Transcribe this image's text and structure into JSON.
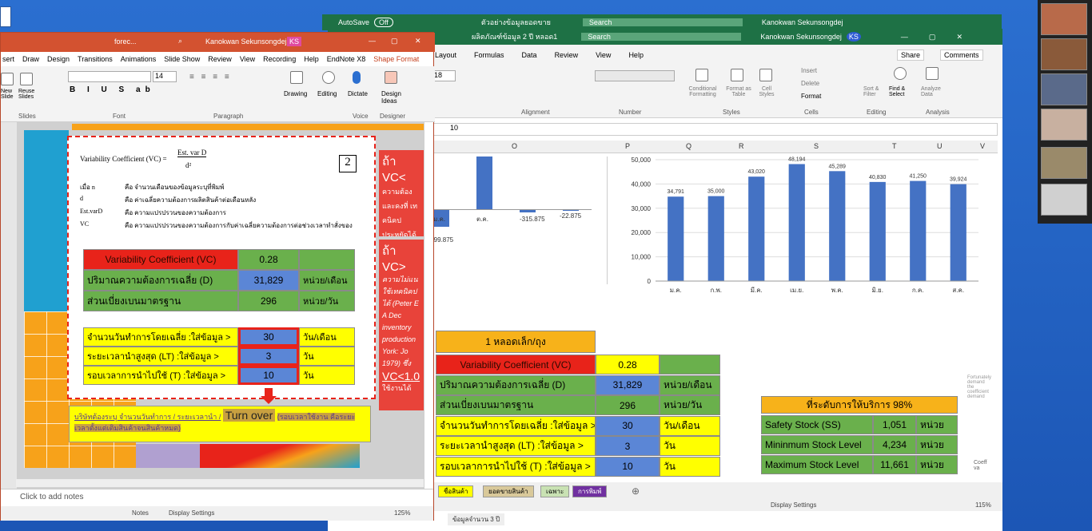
{
  "excel_back": {
    "autosave": "AutoSave",
    "autosave_state": "Off",
    "title": "ตัวอย่างข้อมูลยอดขาย",
    "search": "Search",
    "user": "Kanokwan Sekunsongdej",
    "initials": "KS"
  },
  "excel": {
    "title": "ผลิตภัณฑ์ข้อมูล 2 ปี หลอด1",
    "search": "Search",
    "user": "Kanokwan Sekunsongdej",
    "initials": "KS",
    "menu": [
      "Layout",
      "Formulas",
      "Data",
      "Review",
      "View",
      "Help"
    ],
    "share": "Share",
    "comments": "Comments",
    "ribbon_groups": [
      "Alignment",
      "Number",
      "Styles",
      "Cells",
      "Editing",
      "Analysis"
    ],
    "ribbon_items": {
      "font_size": "18",
      "insert": "Insert",
      "delete": "Delete",
      "format": "Format",
      "cond_fmt": "Conditional Formatting",
      "format_table": "Format as Table",
      "cell_styles": "Cell Styles",
      "sort": "Sort & Filter",
      "find": "Find & Select",
      "analyze": "Analyze Data"
    },
    "formula_value": "10",
    "columns": [
      "O",
      "P",
      "Q",
      "R",
      "S",
      "T",
      "U",
      "V"
    ],
    "neg_chart": {
      "labels": [
        "ม.ค.",
        "ต.ค.",
        "-315.875",
        "-22.875"
      ],
      "left_value": "-99.875"
    },
    "chart_data": {
      "type": "bar",
      "categories": [
        "ม.ค.",
        "ก.พ.",
        "มี.ค.",
        "เม.ย.",
        "พ.ค.",
        "มิ.ย.",
        "ก.ค.",
        "ส.ค."
      ],
      "values": [
        34791,
        35000,
        43020,
        48194,
        45289,
        40830,
        41250,
        39924
      ],
      "value_labels": [
        "34,791",
        "35,000",
        "43,020",
        "48,194",
        "45,289",
        "40,830",
        "41,250",
        "39,924"
      ],
      "ylim": [
        0,
        50000
      ],
      "yticks": [
        "50,000",
        "40,000",
        "30,000",
        "20,000",
        "10,000",
        "0"
      ]
    },
    "table": {
      "header": "1 หลอดเล็ก/ถุง",
      "rows": [
        [
          "Variability Coefficient (VC)",
          "0.28",
          ""
        ],
        [
          "ปริมาณความต้องการเฉลี่ย (D)",
          "31,829",
          "หน่วย/เดือน"
        ],
        [
          "ส่วนเบี่ยงเบนมาตรฐาน",
          "296",
          "หน่วย/วัน"
        ],
        [
          "จำนวนวันทำการโดยเฉลี่ย :ใส่ข้อมูล >",
          "30",
          "วัน/เดือน"
        ],
        [
          "ระยะเวลานำสูงสุด (LT) :ใส่ข้อมูล >",
          "3",
          "วัน"
        ],
        [
          "รอบเวลาการนำไปใช้ (T) :ใส่ข้อมูล >",
          "10",
          "วัน"
        ]
      ]
    },
    "service": {
      "header": "ที่ระดับการให้บริการ 98%",
      "rows": [
        [
          "Safety Stock (SS)",
          "1,051",
          "หน่วย"
        ],
        [
          "Mininmum Stock Level",
          "4,234",
          "หน่วย"
        ],
        [
          "Maximum Stock Level",
          "11,661",
          "หน่วย"
        ]
      ]
    },
    "side_note": "Fortunately demand the coefficient demand",
    "side_note2": "Coeff va",
    "sheet_tabs": [
      "ชื่อสินค้า",
      "ยอดขายสินค้า",
      "เฉพาะ",
      "การพิมพ์"
    ],
    "status": {
      "display": "Display Settings",
      "zoom": "115%"
    },
    "back_tab": "ข้อมูลจำนวน 3 ปี"
  },
  "ppt": {
    "title": "forec...",
    "user": "Kanokwan Sekunsongdej",
    "initials": "KS",
    "menu": [
      "sert",
      "Draw",
      "Design",
      "Transitions",
      "Animations",
      "Slide Show",
      "Review",
      "View",
      "Recording",
      "Help",
      "EndNote X8",
      "Shape Format"
    ],
    "groups": [
      "Slides",
      "Font",
      "Paragraph",
      "Voice",
      "Designer"
    ],
    "tools": {
      "new": "New Slide",
      "reuse": "Reuse Slides",
      "drawing": "Drawing",
      "editing": "Editing",
      "dictate": "Dictate",
      "design_ideas": "Design Ideas",
      "font_size": "14"
    },
    "formula": {
      "lhs": "Variability Coefficient (VC) =",
      "num": "Est. var D",
      "den": "d²",
      "num_badge": "2"
    },
    "defs": [
      [
        "เมื่อ n",
        "คือ จำนวนเดือนของข้อมูลระบุที่พิมพ์"
      ],
      [
        "d",
        "คือ ค่าเฉลี่ยความต้องการผลิตสินค้าต่อเดือนหลัง"
      ],
      [
        "Est.varD",
        "คือ ความแปรปรวนของความต้องการ"
      ],
      [
        "VC",
        "คือ ความแปรปรวนของความต้องการกับค่าเฉลี่ยความต้องการต่อช่วงเวลาทำสั่งของ"
      ]
    ],
    "table": {
      "rows": [
        [
          "Variability Coefficient (VC)",
          "0.28",
          ""
        ],
        [
          "ปริมาณความต้องการเฉลี่ย (D)",
          "31,829",
          "หน่วย/เดือน"
        ],
        [
          "ส่วนเบี่ยงเบนมาตรฐาน",
          "296",
          "หน่วย/วัน"
        ]
      ],
      "input_rows": [
        [
          "จำนวนวันทำการโดยเฉลี่ย :ใส่ข้อมูล >",
          "30",
          "วัน/เดือน"
        ],
        [
          "ระยะเวลานำสูงสุด (LT) :ใส่ข้อมูล >",
          "3",
          "วัน"
        ],
        [
          "รอบเวลาการนำไปใช้ (T) :ใส่ข้อมูล >",
          "10",
          "วัน"
        ]
      ]
    },
    "note_text_a": "บริษัทต้องระบุ จำนวนวันทำการ / ระยะเวลานำ /",
    "note_turn": "Turn over",
    "note_text_b": "(รอบเวลาใช้งาน คือระยะเวลาตั้งแต่เติมสินค้าจนสินค้าหมด)",
    "side_panel": {
      "vc1": "ถ้า VC<",
      "vc1_text": "ความต้อง และคงที่ เทคนิคป ประหยัดได้",
      "vc2": "ถ้า VC>",
      "vc2_text": "ความไม่แน ใช้เทคนิคป ได้ (Peter E A Dec inventory production York: Jo 1979) ซึ่ง",
      "vc3": "VC<1.0",
      "vc3_text": "ใช้งานได้"
    },
    "notes": "Click to add notes",
    "status": {
      "notes": "Notes",
      "display": "Display Settings",
      "zoom": "125%"
    }
  }
}
